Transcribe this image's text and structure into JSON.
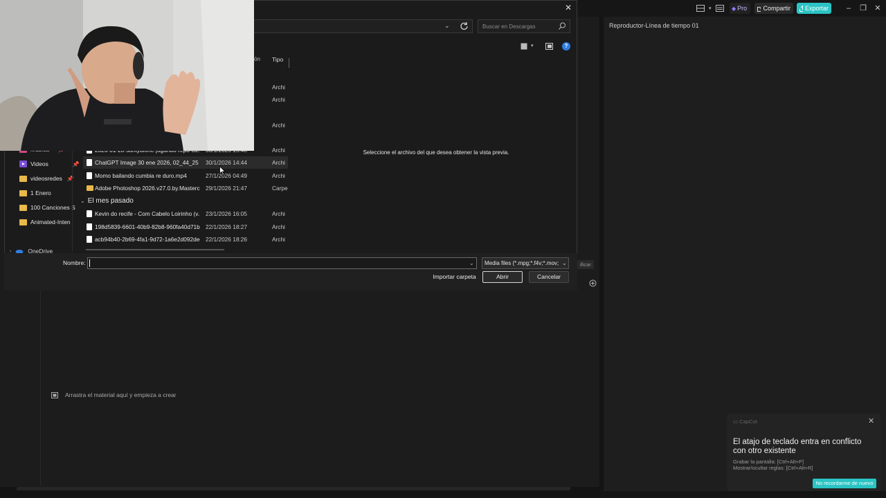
{
  "app": {
    "pro_label": "Pro",
    "share_label": "Compartir",
    "export_label": "Exportar",
    "player_title": "Reproductor-Línea de tiempo 01",
    "timeline_hint": "Arrastra el material aquí y empieza a crear",
    "side_peek": "ificar"
  },
  "toast": {
    "app_name": "CapCut",
    "title": "El atajo de teclado entra en conflicto con otro existente",
    "lines": [
      "Grabar la pantalla: [Ctrl+Alt+P]",
      "Mostrar/ocultar reglas: [Ctrl+Alt+R]"
    ],
    "button": "No recordarme de nuevo"
  },
  "dialog": {
    "search_placeholder": "Buscar en Descargas",
    "help": "?",
    "col_partial": "ón",
    "col_type": "Tipo",
    "preview_text": "Seleccione el archivo del que desea obtener la vista previa.",
    "nav": [
      {
        "label": "Música"
      },
      {
        "label": "Videos"
      },
      {
        "label": "videosredes"
      },
      {
        "label": "1 Enero"
      },
      {
        "label": "100 Canciones S"
      },
      {
        "label": "Animated-Inten"
      }
    ],
    "onedrive": "OneDrive",
    "early_types": [
      "Archi",
      "Archi",
      "Archi"
    ],
    "files": [
      {
        "name": "2026-01-28-santyalone-jugando-repo-co...",
        "date": "30/1/2026 15:48",
        "type": "Archi"
      },
      {
        "name": "ChatGPT Image 30 ene 2026, 02_44_25 p...",
        "date": "30/1/2026 14:44",
        "type": "Archi"
      },
      {
        "name": "Momo bailando cumbia re duro.mp4",
        "date": "27/1/2026 04:49",
        "type": "Archi"
      },
      {
        "name": "Adobe Photoshop 2026.v27.0.by.Masterci...",
        "date": "29/1/2026 21:47",
        "type": "Carpe"
      }
    ],
    "group_header": "El mes pasado",
    "files_last_month": [
      {
        "name": "Kevin do recife - Com Cabelo Loirinho (v...",
        "date": "23/1/2026 16:05",
        "type": "Archi"
      },
      {
        "name": "198d5839-6601-40b9-82b8-960fa40d71be...",
        "date": "22/1/2026 18:27",
        "type": "Archi"
      },
      {
        "name": "acb94b40-2b69-4fa1-9d72-1a6e2d092dec...",
        "date": "22/1/2026 18:26",
        "type": "Archi"
      }
    ],
    "name_label": "Nombre:",
    "name_value": "",
    "filetype": "Media files (*.mpg;*.f4v;*.mov;",
    "btn_import": "Importar carpeta",
    "btn_open": "Abrir",
    "btn_cancel": "Cancelar"
  },
  "colors": {
    "accent": "#2bc4c4",
    "help_blue": "#2f7ee0",
    "folder": "#e9b949"
  }
}
